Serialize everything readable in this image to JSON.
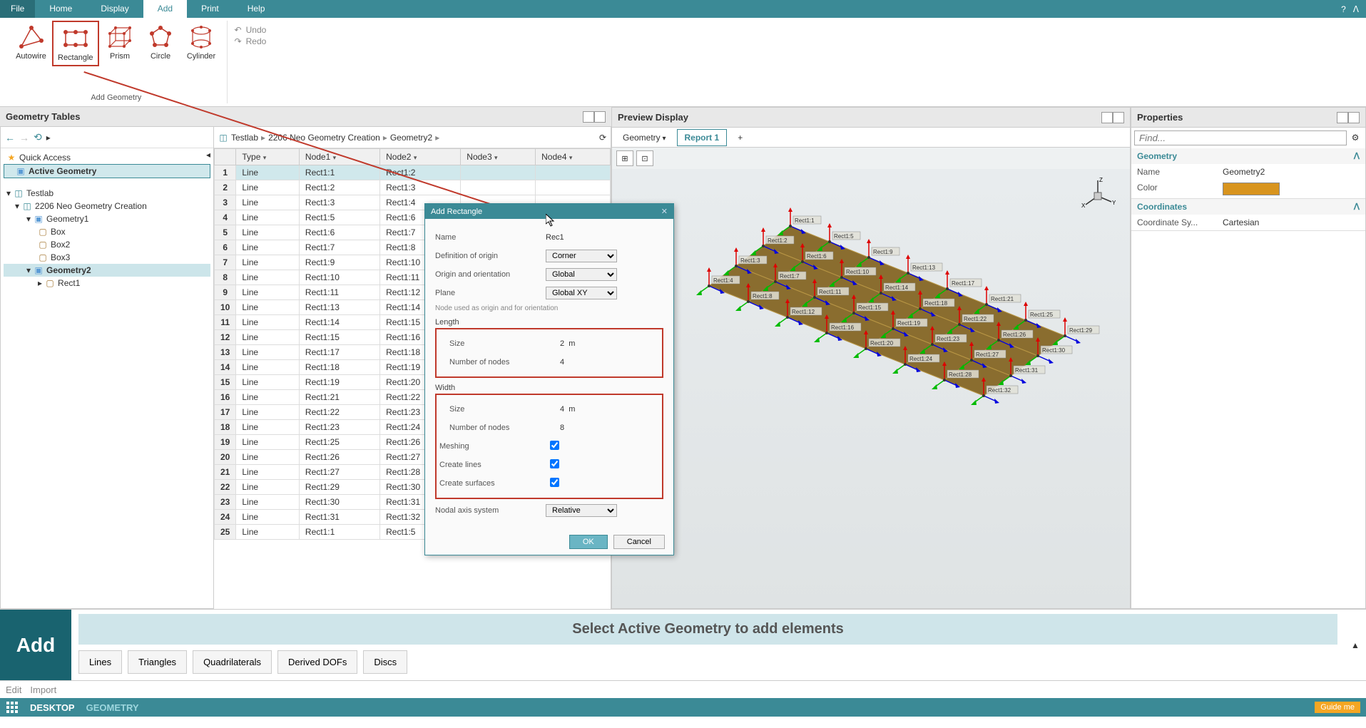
{
  "menu": {
    "file": "File",
    "home": "Home",
    "display": "Display",
    "add": "Add",
    "print": "Print",
    "help": "Help"
  },
  "ribbon": {
    "buttons": [
      "Autowire",
      "Rectangle",
      "Prism",
      "Circle",
      "Cylinder"
    ],
    "undo": "Undo",
    "redo": "Redo",
    "group_title": "Add Geometry"
  },
  "panels": {
    "left_title": "Geometry Tables",
    "preview_title": "Preview Display",
    "props_title": "Properties"
  },
  "breadcrumb": {
    "root": "Testlab",
    "path1": "2206 Neo Geometry Creation",
    "path2": "Geometry2"
  },
  "tree": {
    "quick_access": "Quick Access",
    "active_geometry": "Active Geometry",
    "root": "Testlab",
    "project": "2206 Neo Geometry Creation",
    "geometry1": "Geometry1",
    "box1": "Box",
    "box2": "Box2",
    "box3": "Box3",
    "geometry2": "Geometry2",
    "rect1": "Rect1"
  },
  "table": {
    "headers": [
      "Type",
      "Node1",
      "Node2",
      "Node3",
      "Node4"
    ],
    "rows": [
      [
        "1",
        "Line",
        "Rect1:1",
        "Rect1:2",
        "",
        ""
      ],
      [
        "2",
        "Line",
        "Rect1:2",
        "Rect1:3",
        "",
        ""
      ],
      [
        "3",
        "Line",
        "Rect1:3",
        "Rect1:4",
        "",
        ""
      ],
      [
        "4",
        "Line",
        "Rect1:5",
        "Rect1:6",
        "",
        ""
      ],
      [
        "5",
        "Line",
        "Rect1:6",
        "Rect1:7",
        "",
        ""
      ],
      [
        "6",
        "Line",
        "Rect1:7",
        "Rect1:8",
        "",
        ""
      ],
      [
        "7",
        "Line",
        "Rect1:9",
        "Rect1:10",
        "",
        ""
      ],
      [
        "8",
        "Line",
        "Rect1:10",
        "Rect1:11",
        "",
        ""
      ],
      [
        "9",
        "Line",
        "Rect1:11",
        "Rect1:12",
        "",
        ""
      ],
      [
        "10",
        "Line",
        "Rect1:13",
        "Rect1:14",
        "",
        ""
      ],
      [
        "11",
        "Line",
        "Rect1:14",
        "Rect1:15",
        "",
        ""
      ],
      [
        "12",
        "Line",
        "Rect1:15",
        "Rect1:16",
        "",
        ""
      ],
      [
        "13",
        "Line",
        "Rect1:17",
        "Rect1:18",
        "",
        ""
      ],
      [
        "14",
        "Line",
        "Rect1:18",
        "Rect1:19",
        "",
        ""
      ],
      [
        "15",
        "Line",
        "Rect1:19",
        "Rect1:20",
        "",
        ""
      ],
      [
        "16",
        "Line",
        "Rect1:21",
        "Rect1:22",
        "",
        ""
      ],
      [
        "17",
        "Line",
        "Rect1:22",
        "Rect1:23",
        "",
        ""
      ],
      [
        "18",
        "Line",
        "Rect1:23",
        "Rect1:24",
        "",
        ""
      ],
      [
        "19",
        "Line",
        "Rect1:25",
        "Rect1:26",
        "",
        ""
      ],
      [
        "20",
        "Line",
        "Rect1:26",
        "Rect1:27",
        "",
        ""
      ],
      [
        "21",
        "Line",
        "Rect1:27",
        "Rect1:28",
        "",
        ""
      ],
      [
        "22",
        "Line",
        "Rect1:29",
        "Rect1:30",
        "",
        ""
      ],
      [
        "23",
        "Line",
        "Rect1:30",
        "Rect1:31",
        "",
        ""
      ],
      [
        "24",
        "Line",
        "Rect1:31",
        "Rect1:32",
        "",
        ""
      ],
      [
        "25",
        "Line",
        "Rect1:1",
        "Rect1:5",
        "",
        ""
      ]
    ]
  },
  "preview": {
    "tab_geometry": "Geometry",
    "tab_report": "Report 1"
  },
  "props": {
    "section_geometry": "Geometry",
    "name_label": "Name",
    "name_value": "Geometry2",
    "color_label": "Color",
    "section_coords": "Coordinates",
    "coord_label": "Coordinate Sy...",
    "coord_value": "Cartesian",
    "find_placeholder": "Find..."
  },
  "dialog": {
    "title": "Add Rectangle",
    "name_label": "Name",
    "name_value": "Rec1",
    "def_label": "Definition of origin",
    "def_value": "Corner",
    "origin_label": "Origin and orientation",
    "origin_value": "Global",
    "plane_label": "Plane",
    "plane_value": "Global XY",
    "note": "Node used as origin and for orientation",
    "length_section": "Length",
    "length_size_label": "Size",
    "length_size_value": "2",
    "length_unit": "m",
    "length_nodes_label": "Number of nodes",
    "length_nodes_value": "4",
    "width_section": "Width",
    "width_size_label": "Size",
    "width_size_value": "4",
    "width_unit": "m",
    "width_nodes_label": "Number of nodes",
    "width_nodes_value": "8",
    "meshing_label": "Meshing",
    "lines_label": "Create lines",
    "surfaces_label": "Create surfaces",
    "axis_label": "Nodal axis system",
    "axis_value": "Relative",
    "ok": "OK",
    "cancel": "Cancel"
  },
  "bottom": {
    "add": "Add",
    "banner": "Select Active Geometry to add elements",
    "btn_lines": "Lines",
    "btn_triangles": "Triangles",
    "btn_quads": "Quadrilaterals",
    "btn_dofs": "Derived DOFs",
    "btn_discs": "Discs",
    "tab_edit": "Edit",
    "tab_import": "Import"
  },
  "status": {
    "desktop": "DESKTOP",
    "geometry": "GEOMETRY",
    "guide": "Guide me"
  },
  "mesh_nodes": [
    "Rect1:1",
    "Rect1:2",
    "Rect1:3",
    "Rect1:4",
    "Rect1:5",
    "Rect1:6",
    "Rect1:7",
    "Rect1:8",
    "Rect1:9",
    "Rect1:10",
    "Rect1:11",
    "Rect1:12",
    "Rect1:13",
    "Rect1:14",
    "Rect1:15",
    "Rect1:16",
    "Rect1:17",
    "Rect1:18",
    "Rect1:19",
    "Rect1:20",
    "Rect1:21",
    "Rect1:22",
    "Rect1:23",
    "Rect1:24",
    "Rect1:25",
    "Rect1:26",
    "Rect1:27",
    "Rect1:28",
    "Rect1:29",
    "Rect1:30",
    "Rect1:31",
    "Rect1:32"
  ]
}
